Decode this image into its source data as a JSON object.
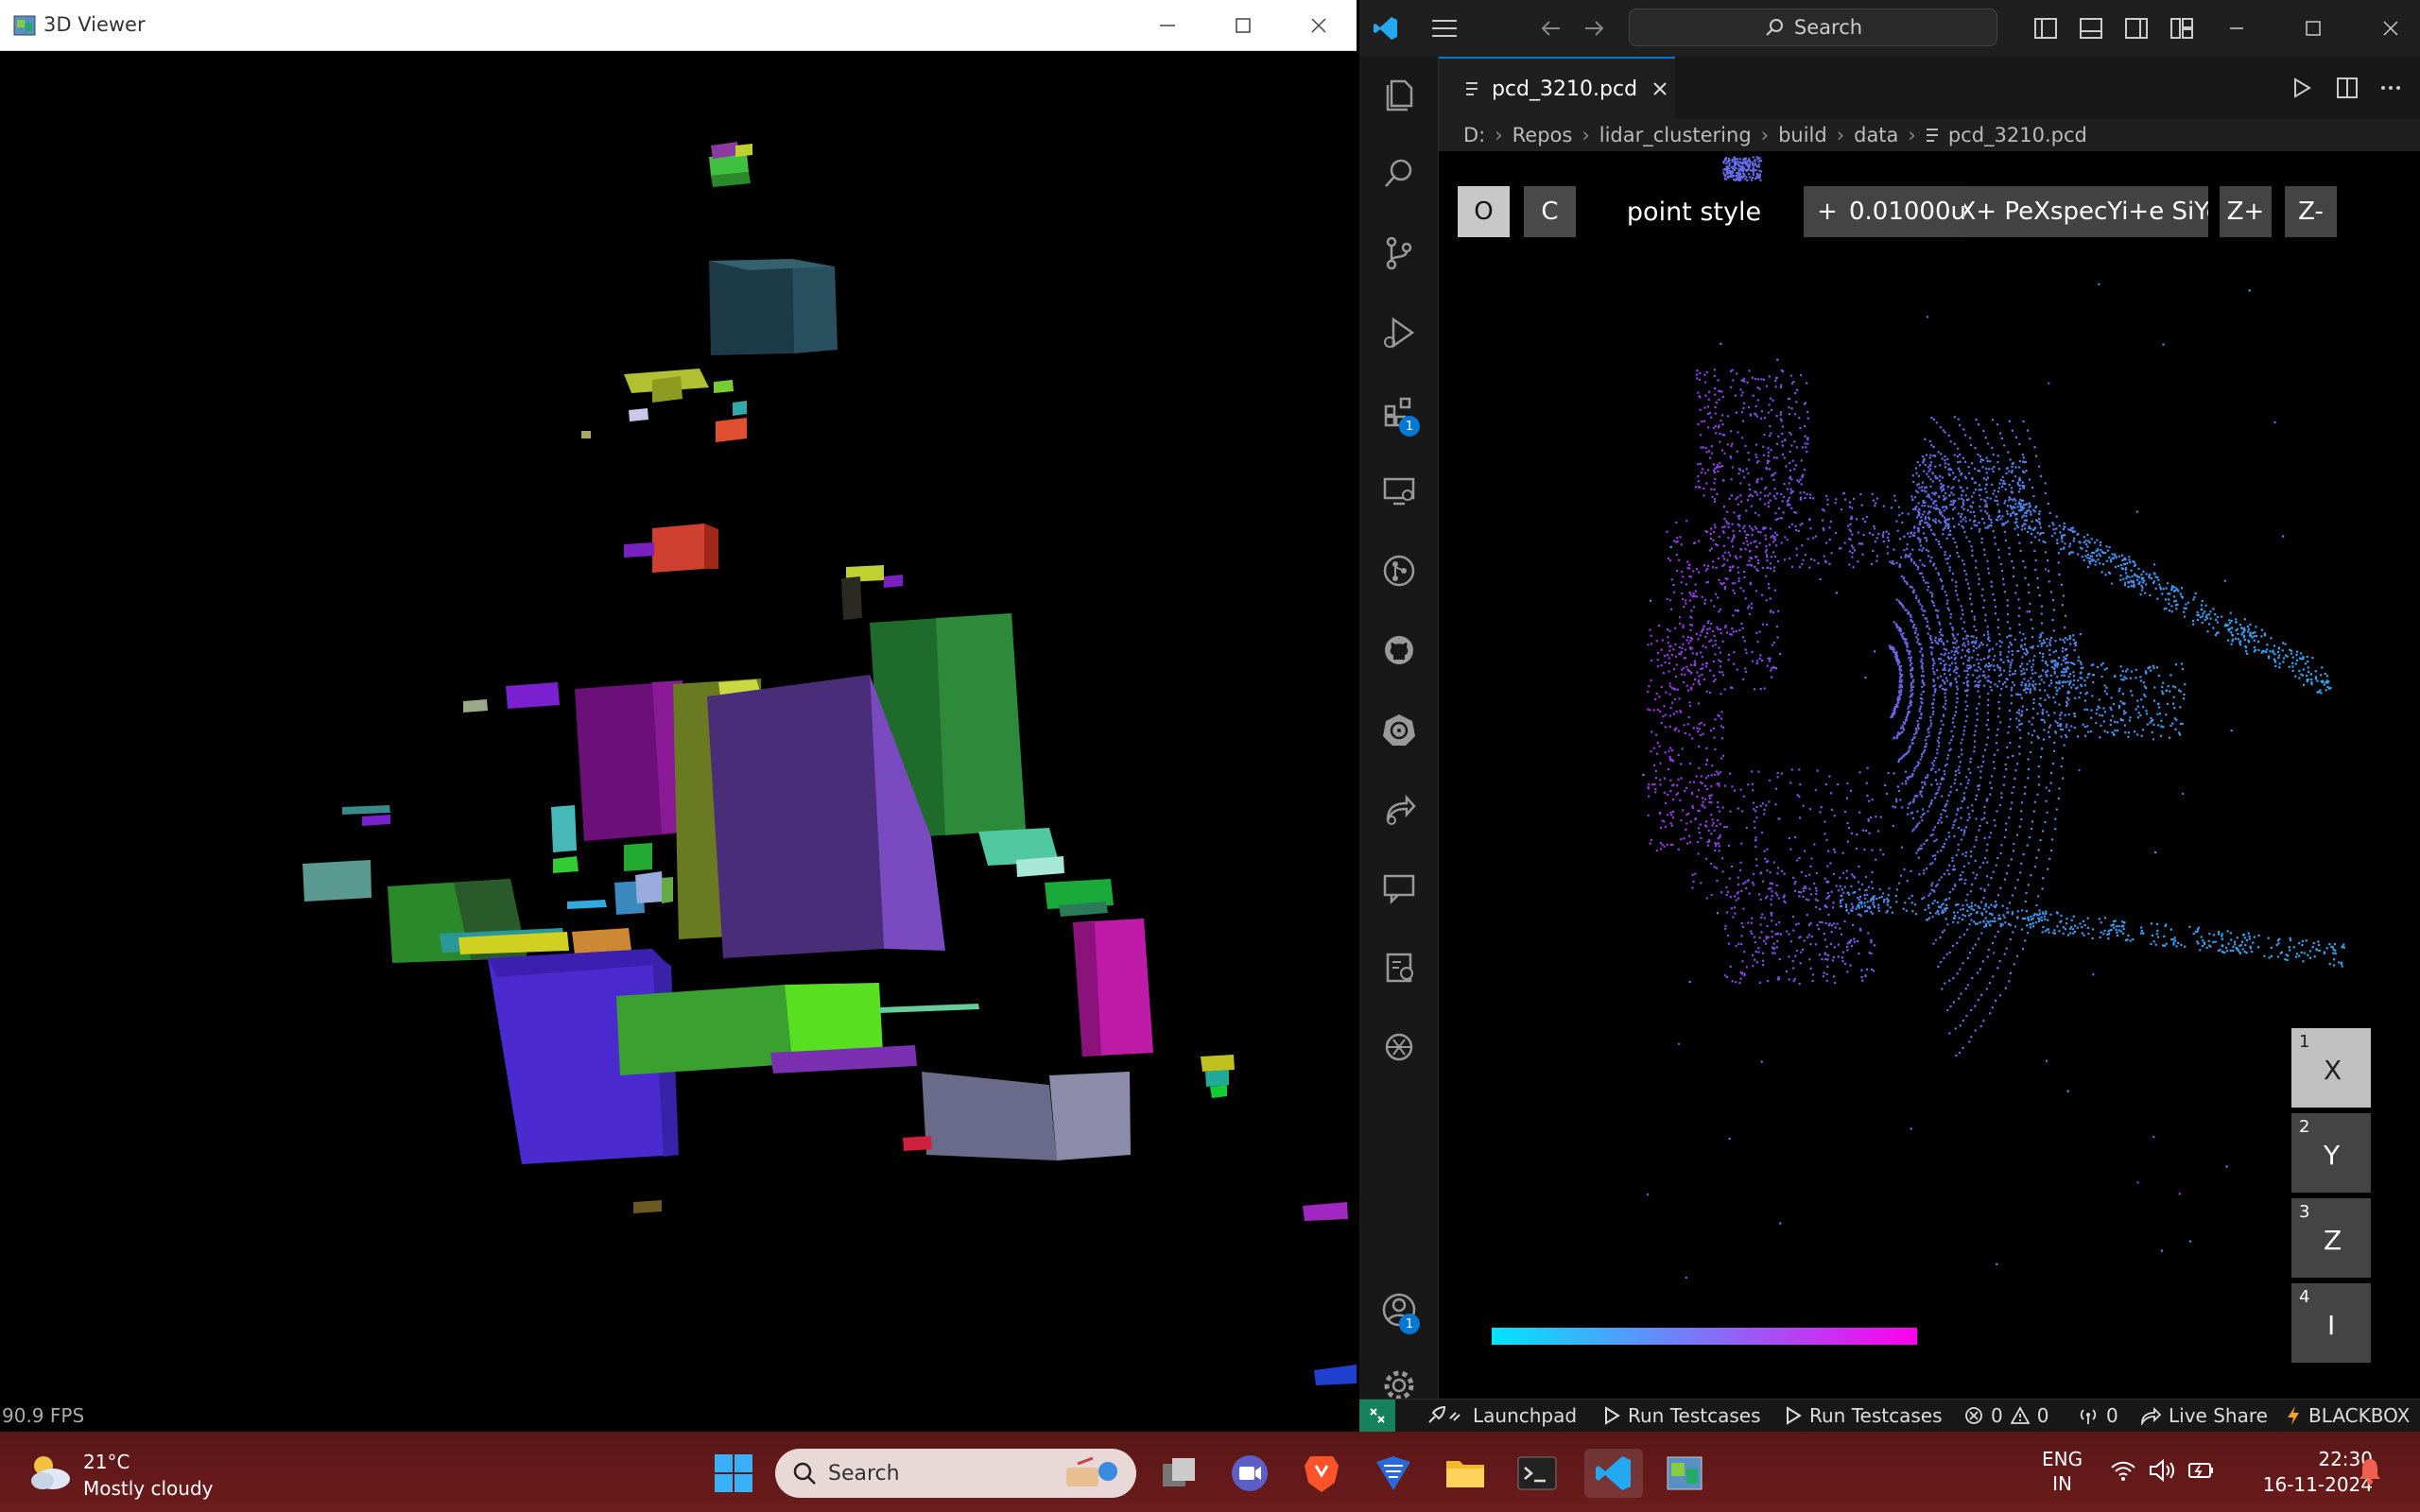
{
  "viewer": {
    "title": "3D Viewer",
    "fps": "90.9 FPS"
  },
  "vscode": {
    "search_label": "Search",
    "tab_label": "pcd_3210.pcd",
    "breadcrumb": [
      "D:",
      "Repos",
      "lidar_clustering",
      "build",
      "data",
      "pcd_3210.pcd"
    ],
    "activity_badges": {
      "extensions": "1",
      "accounts": "1"
    },
    "toolbar": {
      "o_button": "O",
      "c_button": "C",
      "point_style_label": "point style",
      "plus_button": "+",
      "size_value": "0.01000u",
      "overlap_text": "-X+ PeXspecYi+e SiYe",
      "zplus_button": "Z+",
      "zminus_button": "Z-"
    },
    "axis_buttons": [
      {
        "num": "1",
        "label": "X"
      },
      {
        "num": "2",
        "label": "Y"
      },
      {
        "num": "3",
        "label": "Z"
      },
      {
        "num": "4",
        "label": "I"
      }
    ],
    "colorbar": {
      "start_color": "#00e5ff",
      "end_color": "#ff00ee"
    },
    "status": {
      "launchpad": "Launchpad",
      "run1": "Run Testcases",
      "run2": "Run Testcases",
      "errors": "0",
      "warnings": "0",
      "ports": "0",
      "live_share": "Live Share",
      "blackbox": "BLACKBOX"
    }
  },
  "taskbar": {
    "weather_temp": "21°C",
    "weather_desc": "Mostly cloudy",
    "search_placeholder": "Search",
    "lang": "ENG",
    "region": "IN",
    "time": "22:30",
    "date": "16-11-2024"
  }
}
